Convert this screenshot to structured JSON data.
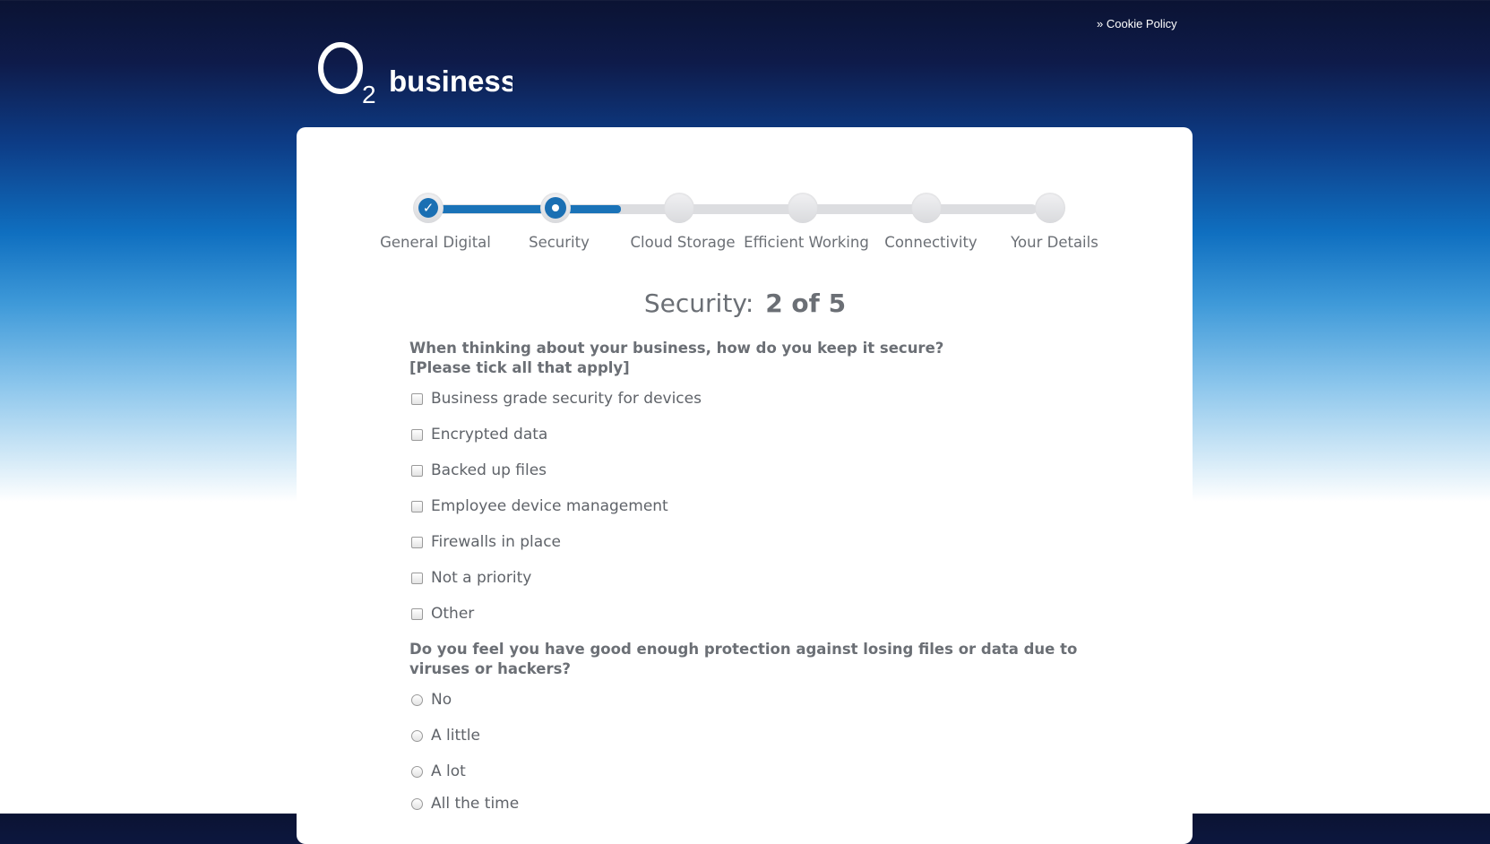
{
  "header": {
    "cookie_link": "» Cookie Policy",
    "logo_text": "O2 business"
  },
  "stepper": {
    "steps": [
      {
        "label": "General Digital",
        "status": "complete"
      },
      {
        "label": "Security",
        "status": "current"
      },
      {
        "label": "Cloud Storage",
        "status": "upcoming"
      },
      {
        "label": "Efficient Working",
        "status": "upcoming"
      },
      {
        "label": "Connectivity",
        "status": "upcoming"
      },
      {
        "label": "Your Details",
        "status": "upcoming"
      }
    ]
  },
  "page": {
    "title_prefix": "Security:",
    "title_progress": "2 of 5"
  },
  "questions": [
    {
      "line1": "When thinking about your business, how do you keep it secure?",
      "line2": "[Please tick all that apply]",
      "type": "checkbox",
      "options": [
        "Business grade security for devices",
        "Encrypted data",
        "Backed up files",
        "Employee device management",
        "Firewalls in place",
        "Not a priority",
        "Other"
      ]
    },
    {
      "line1": "Do you feel you have good enough protection against losing files or data due to",
      "line2": "viruses or hackers?",
      "type": "radio",
      "options": [
        "No",
        "A little",
        "A lot",
        "All the time"
      ]
    }
  ],
  "colors": {
    "accent": "#1a6fb3",
    "text": "#6b6f75",
    "header_dark": "#0b1333"
  }
}
